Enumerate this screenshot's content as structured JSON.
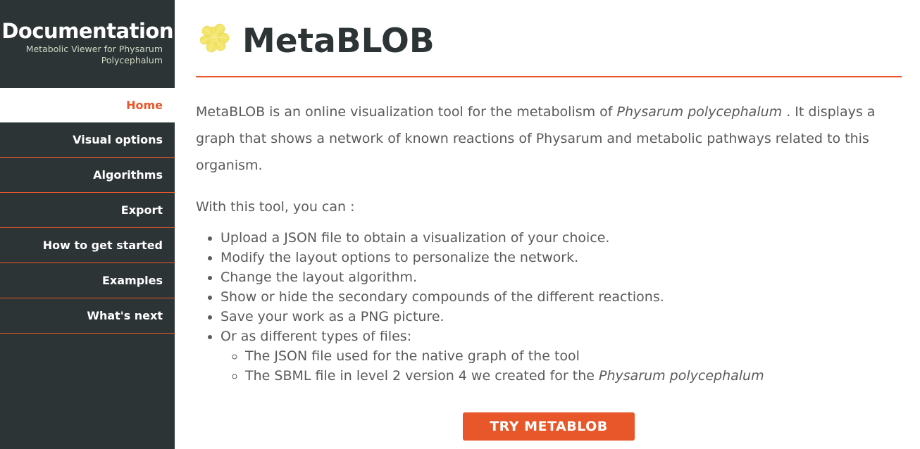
{
  "sidebar": {
    "title": "Documentation",
    "subtitle": "Metabolic Viewer for Physarum Polycephalum",
    "items": [
      {
        "label": "Home",
        "active": true
      },
      {
        "label": "Visual options"
      },
      {
        "label": "Algorithms"
      },
      {
        "label": "Export"
      },
      {
        "label": "How to get started"
      },
      {
        "label": "Examples"
      },
      {
        "label": "What's next"
      }
    ]
  },
  "header": {
    "logo_icon": "physarum-logo-icon",
    "title": "MetaBLOB"
  },
  "content": {
    "intro_before": "MetaBLOB is an online visualization tool for the metabolism of ",
    "intro_species": "Physarum polycephalum",
    "intro_after": " . It displays a graph that shows a network of known reactions of Physarum and metabolic pathways related to this organism.",
    "lead": "With this tool, you can :",
    "features": [
      "Upload a JSON file to obtain a visualization of your choice.",
      "Modify the layout options to personalize the network.",
      "Change the layout algorithm.",
      "Show or hide the secondary compounds of the different reactions.",
      "Save your work as a PNG picture.",
      "Or as different types of files:"
    ],
    "subfeatures": [
      {
        "text": "The JSON file used for the native graph of the tool"
      },
      {
        "text": "The SBML file in level 2 version 4 we created for the ",
        "em": "Physarum polycephalum"
      }
    ],
    "cta_label": "TRY METABLOB"
  },
  "colors": {
    "sidebar_bg": "#2d3436",
    "accent": "#e8572a",
    "text": "#5a5a5a",
    "logo": "#f3e56a"
  }
}
